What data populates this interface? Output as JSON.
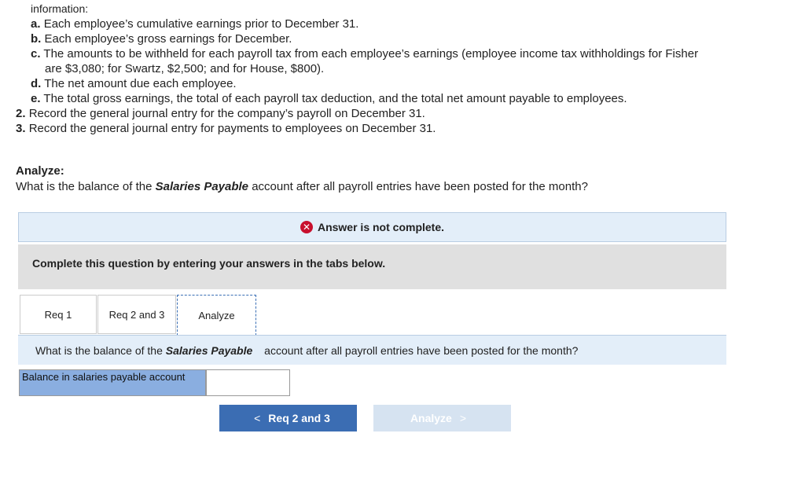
{
  "intro_partial": "information:",
  "list_items": [
    {
      "marker": "a.",
      "text": "Each employee’s cumulative earnings prior to December 31."
    },
    {
      "marker": "b.",
      "text": "Each employee’s gross earnings for December."
    },
    {
      "marker": "c.",
      "text": "The amounts to be withheld for each payroll tax from each employee’s earnings (employee income tax withholdings for Fisher",
      "cont": "are $3,080; for Swartz, $2,500; and for House, $800)."
    },
    {
      "marker": "d.",
      "text": "The net amount due each employee."
    },
    {
      "marker": "e.",
      "text": "The total gross earnings, the total of each payroll tax deduction, and the total net amount payable to employees."
    }
  ],
  "steps": [
    {
      "marker": "2.",
      "text": "Record the general journal entry for the company’s payroll on December 31."
    },
    {
      "marker": "3.",
      "text": "Record the general journal entry for payments to employees on December 31."
    }
  ],
  "analyze": {
    "heading": "Analyze:",
    "question_pre": "What is the balance of the ",
    "question_bold": "Salaries Payable",
    "question_post": " account after all payroll entries have been posted for the month?"
  },
  "banner": {
    "icon": "x-circle-icon",
    "text": "Answer is not complete."
  },
  "instruction": "Complete this question by entering your answers in the tabs below.",
  "tabs": [
    {
      "label": "Req 1"
    },
    {
      "label": "Req 2 and 3"
    },
    {
      "label": "Analyze"
    }
  ],
  "tab_question": {
    "pre": "What is the balance of the ",
    "bold": "Salaries Payable",
    "post": " account after all payroll entries have been posted for the month?"
  },
  "answer_row": {
    "label": "Balance in salaries payable account",
    "value": ""
  },
  "nav": {
    "prev_label": "Req 2 and 3",
    "next_label": "Analyze"
  },
  "colors": {
    "accent": "#3b6db3",
    "error": "#c8102e",
    "banner_bg": "#e3eef9",
    "label_bg": "#8aaee0"
  }
}
